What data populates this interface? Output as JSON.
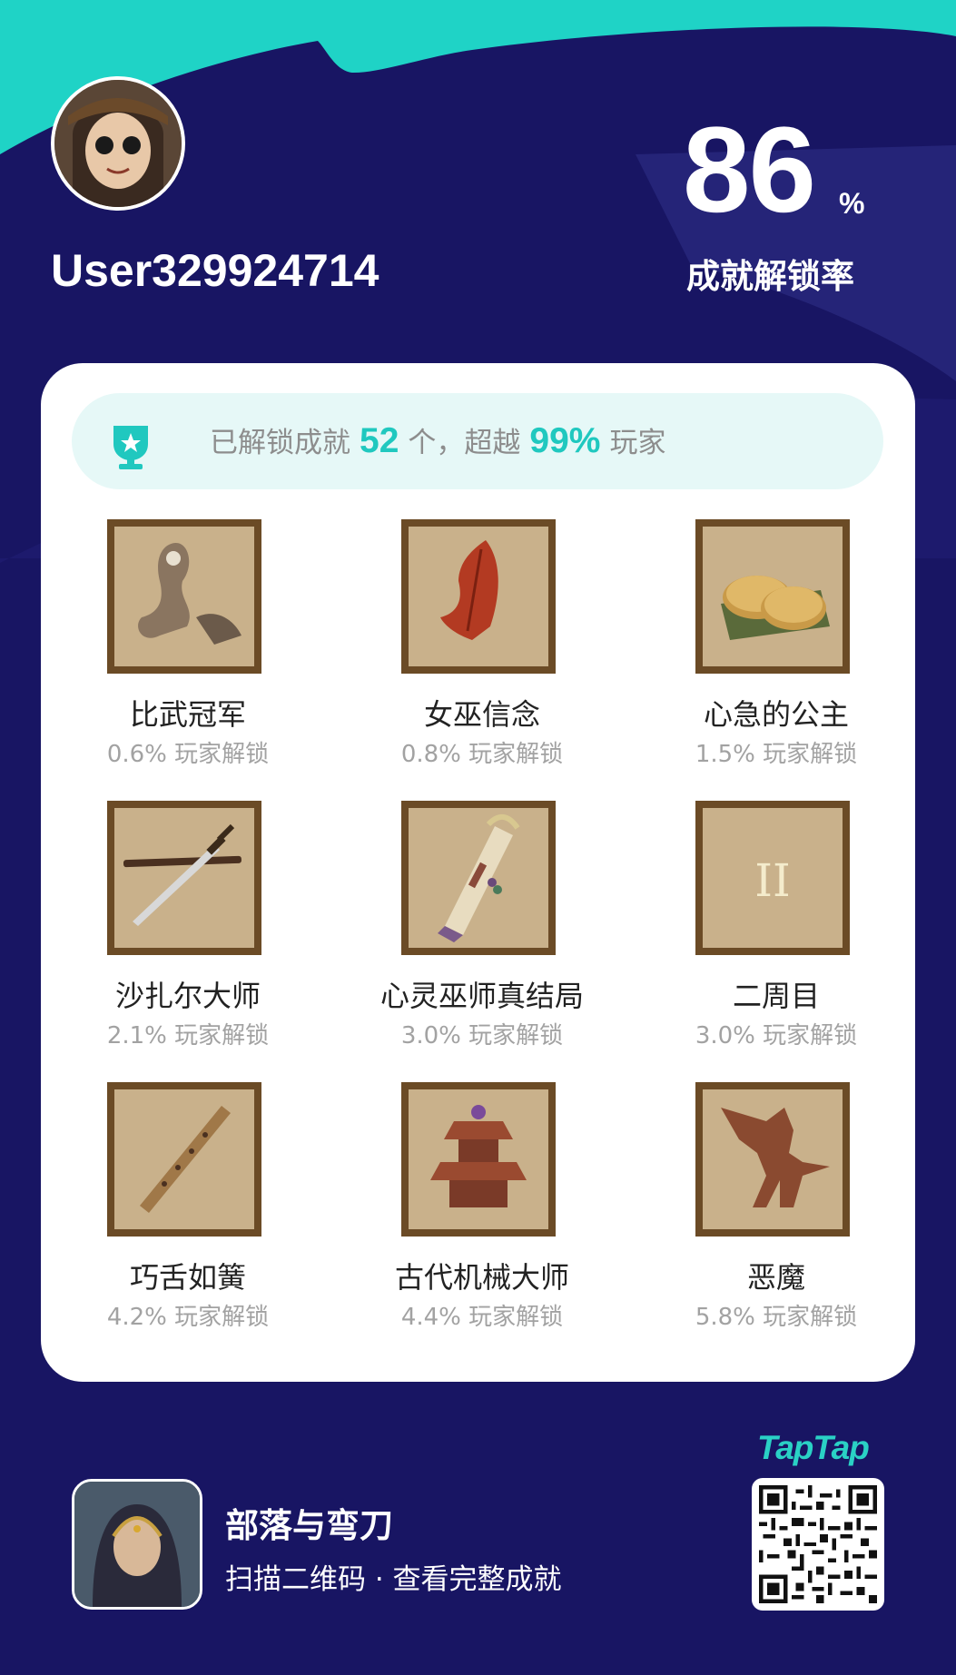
{
  "user": {
    "name": "User329924714",
    "avatar": "user-avatar"
  },
  "stats": {
    "rate_value": "86",
    "rate_suffix": "%",
    "rate_label": "成就解锁率"
  },
  "summary": {
    "prefix": "已解锁成就",
    "count": "52",
    "mid": "个，超越",
    "percent": "99%",
    "suffix": "玩家",
    "icon": "trophy-icon"
  },
  "achievements": [
    {
      "name": "比武冠军",
      "pct": "0.6% 玩家解锁",
      "icon": "champion-figure-icon"
    },
    {
      "name": "女巫信念",
      "pct": "0.8% 玩家解锁",
      "icon": "red-leaf-icon"
    },
    {
      "name": "心急的公主",
      "pct": "1.5% 玩家解锁",
      "icon": "flatbread-icon"
    },
    {
      "name": "沙扎尔大师",
      "pct": "2.1% 玩家解锁",
      "icon": "sword-icon"
    },
    {
      "name": "心灵巫师真结局",
      "pct": "3.0% 玩家解锁",
      "icon": "scroll-icon"
    },
    {
      "name": "二周目",
      "pct": "3.0% 玩家解锁",
      "icon": "roman-two-icon",
      "glyph": "II"
    },
    {
      "name": "巧舌如簧",
      "pct": "4.2% 玩家解锁",
      "icon": "flute-icon"
    },
    {
      "name": "古代机械大师",
      "pct": "4.4% 玩家解锁",
      "icon": "pagoda-machine-icon"
    },
    {
      "name": "恶魔",
      "pct": "5.8% 玩家解锁",
      "icon": "demon-icon"
    }
  ],
  "footer": {
    "game_name": "部落与弯刀",
    "sub": "扫描二维码 · 查看完整成就",
    "brand": "TapTap",
    "game_icon": "game-cover-icon",
    "qr": "qr-code"
  },
  "colors": {
    "background": "#181563",
    "accent": "#20c8bf",
    "card": "#ffffff",
    "frame": "#6b4b26"
  }
}
